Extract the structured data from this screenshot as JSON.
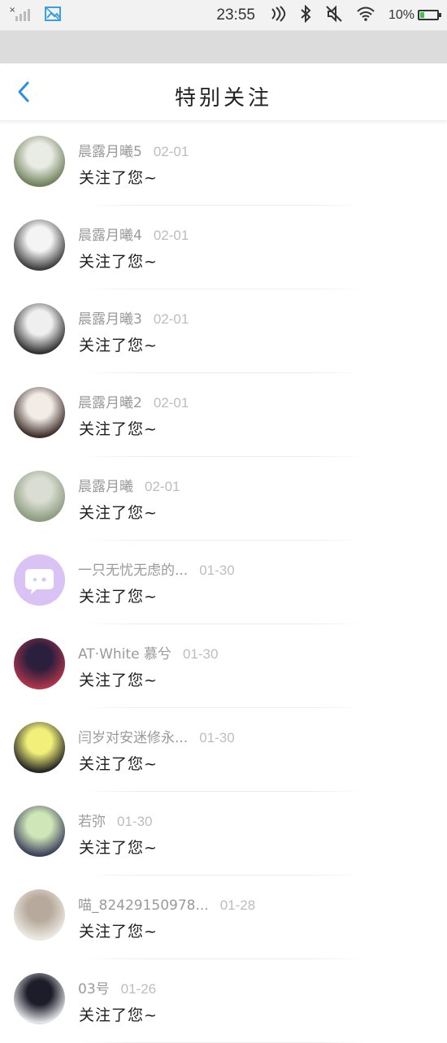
{
  "status_bar": {
    "time": "23:55",
    "battery": "10%"
  },
  "header": {
    "title": "特别关注"
  },
  "items": [
    {
      "name": "晨露月曦5",
      "date": "02-01",
      "message": "关注了您~",
      "avatar_colors": [
        "#e9ece4",
        "#6f7f5a"
      ]
    },
    {
      "name": "晨露月曦4",
      "date": "02-01",
      "message": "关注了您~",
      "avatar_colors": [
        "#f4f4f4",
        "#3a3a3a"
      ]
    },
    {
      "name": "晨露月曦3",
      "date": "02-01",
      "message": "关注了您~",
      "avatar_colors": [
        "#efefef",
        "#2e2e2e"
      ]
    },
    {
      "name": "晨露月曦2",
      "date": "02-01",
      "message": "关注了您~",
      "avatar_colors": [
        "#f3ece6",
        "#3b2b27"
      ]
    },
    {
      "name": "晨露月曦",
      "date": "02-01",
      "message": "关注了您~",
      "avatar_colors": [
        "#d9ddd2",
        "#8c9a7d"
      ]
    },
    {
      "name": "一只无忧无虑的...",
      "date": "01-30",
      "message": "关注了您~",
      "avatar_colors": [
        "#d8c3f4",
        "#ffffff"
      ]
    },
    {
      "name": "AT·White 慕兮",
      "date": "01-30",
      "message": "关注了您~",
      "avatar_colors": [
        "#2a1f3d",
        "#b0354b"
      ]
    },
    {
      "name": "闫岁对安迷修永...",
      "date": "01-30",
      "message": "关注了您~",
      "avatar_colors": [
        "#f1f07a",
        "#222222"
      ]
    },
    {
      "name": "若弥",
      "date": "01-30",
      "message": "关注了您~",
      "avatar_colors": [
        "#cfe7b8",
        "#3b3d5a"
      ]
    },
    {
      "name": "喵_82429150978...",
      "date": "01-28",
      "message": "关注了您~",
      "avatar_colors": [
        "#b7aa9d",
        "#eeeae4"
      ]
    },
    {
      "name": "03号",
      "date": "01-26",
      "message": "关注了您~",
      "avatar_colors": [
        "#1c1d28",
        "#e8e8ee"
      ]
    }
  ]
}
